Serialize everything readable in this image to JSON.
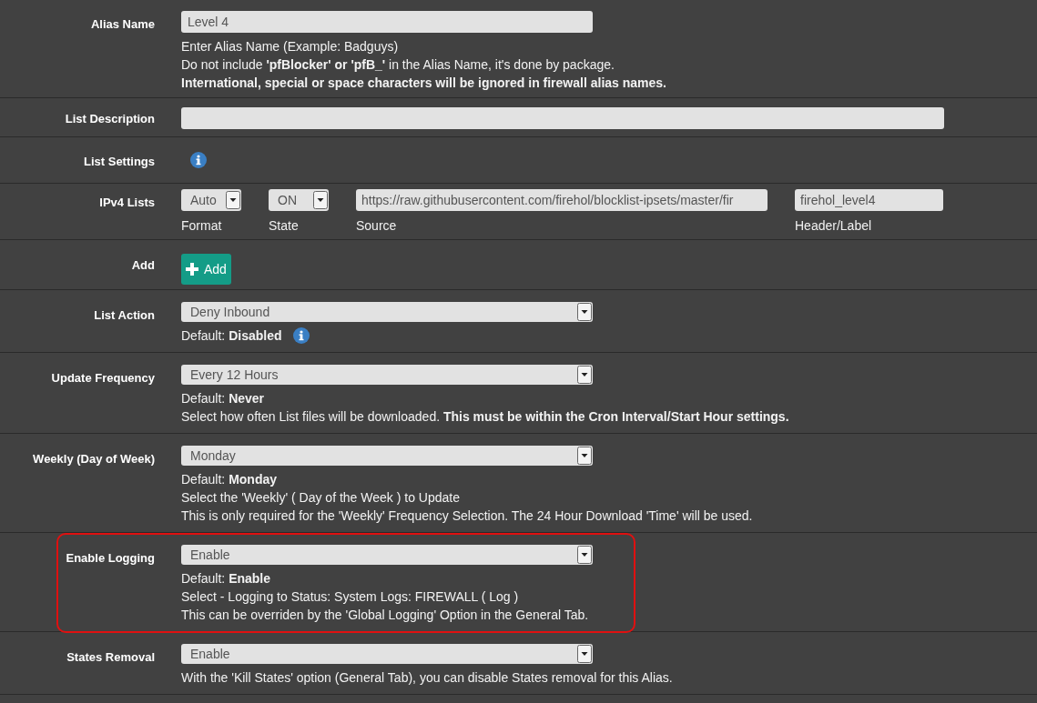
{
  "rows": [
    {
      "label": "Alias Name",
      "kind": "input",
      "value": "Level 4",
      "help": [
        "Enter Alias Name (Example: Badguys)",
        "Do not include **'pfBlocker' or 'pfB_'** in the Alias Name, it's done by package.",
        "**International, special or space characters will be ignored in firewall alias names.**"
      ]
    },
    {
      "label": "List Description",
      "kind": "wide_input"
    },
    {
      "label": "List Settings",
      "kind": "info"
    },
    {
      "label": "IPv4 Lists",
      "kind": "ipv4",
      "format": {
        "value": "Auto",
        "caption": "Format"
      },
      "state": {
        "value": "ON",
        "caption": "State"
      },
      "source": {
        "value": "https://raw.githubusercontent.com/firehol/blocklist-ipsets/master/fir",
        "caption": "Source"
      },
      "header": {
        "value": "firehol_level4",
        "caption": "Header/Label"
      }
    },
    {
      "label": "Add",
      "kind": "button",
      "button": "Add"
    },
    {
      "label": "List Action",
      "kind": "select",
      "value": "Deny Inbound",
      "help": [
        "Default: **Disabled**"
      ],
      "help_info": true
    },
    {
      "label": "Update Frequency",
      "kind": "select",
      "value": "Every 12 Hours",
      "help": [
        "Default: **Never**",
        "Select how often List files will be downloaded. **This must be within the Cron Interval/Start Hour settings.**"
      ]
    },
    {
      "label": "Weekly (Day of Week)",
      "kind": "select",
      "value": "Monday",
      "help": [
        "Default: **Monday**",
        "Select the 'Weekly' ( Day of the Week ) to Update",
        "This is only required for the 'Weekly' Frequency Selection. The 24 Hour Download 'Time' will be used."
      ]
    },
    {
      "label": "Enable Logging",
      "kind": "select",
      "value": "Enable",
      "highlighted": true,
      "help": [
        "Default: **Enable**",
        "Select - Logging to Status: System Logs: FIREWALL ( Log )",
        "This can be overriden by the 'Global Logging' Option in the General Tab."
      ]
    },
    {
      "label": "States Removal",
      "kind": "select",
      "value": "Enable",
      "help": [
        "With the 'Kill States' option (General Tab), you can disable States removal for this Alias."
      ]
    }
  ]
}
